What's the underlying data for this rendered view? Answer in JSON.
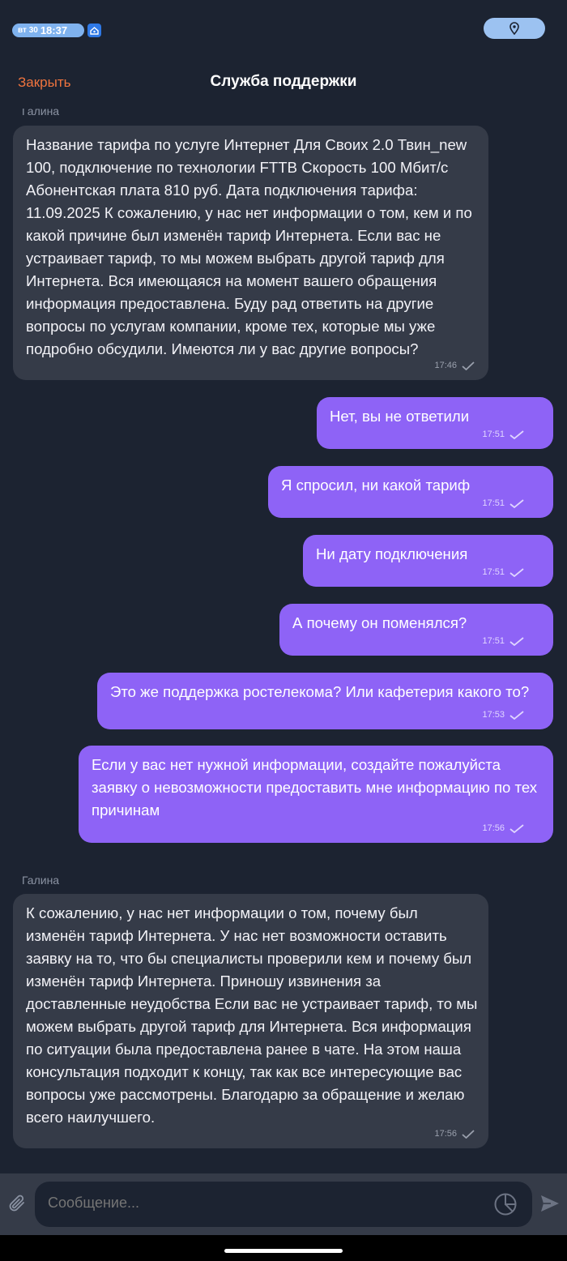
{
  "status": {
    "day": "вт 30",
    "time": "18:37"
  },
  "header": {
    "close_label": "Закрыть",
    "title": "Служба поддержки"
  },
  "messages": [
    {
      "type": "in",
      "sender": "Галина",
      "text": "Название тарифа по услуге Интернет Для Своих 2.0 Твин_new 100, подключение по технологии FTTB Скорость 100 Мбит/с Абонентская плата 810 руб. Дата подключения тарифа: 11.09.2025 К сожалению, у нас нет информации о том, кем и по какой причине был изменён тариф Интернета. Если вас не устраивает тариф, то мы можем выбрать другой тариф для Интернета. Вся имеющаяся на момент вашего обращения информация предоставлена. Буду рад ответить на другие вопросы по услугам компании, кроме тех, которые мы уже подробно обсудили. Имеются ли у вас другие вопросы?",
      "time": "17:46"
    },
    {
      "type": "out",
      "text": "Нет, вы не ответили",
      "time": "17:51"
    },
    {
      "type": "out",
      "text": "Я спросил, ни какой тариф",
      "time": "17:51"
    },
    {
      "type": "out",
      "text": "Ни дату подключения",
      "time": "17:51"
    },
    {
      "type": "out",
      "text": "А почему он поменялся?",
      "time": "17:51"
    },
    {
      "type": "out",
      "text": "Это же поддержка ростелекома? Или кафетерия какого то?",
      "time": "17:53"
    },
    {
      "type": "out",
      "text": "Если у вас нет нужной информации, создайте пожалуйста заявку о невозможности предоставить мне информацию по тех причинам",
      "time": "17:56"
    },
    {
      "type": "in",
      "sender": "Галина",
      "text": "К сожалению, у нас нет информации о том, почему был изменён тариф Интернета. У нас нет возможности оставить заявку на то, что бы специалисты проверили кем и почему был изменён тариф Интернета. Приношу извинения за доставленные неудобства Если вас не устраивает тариф, то мы можем выбрать другой тариф для Интернета. Вся информация по ситуации была предоставлена ранее в чате. На этом наша консультация подходит к концу, так как все интересующие вас вопросы уже рассмотрены. Благодарю за обращение и желаю всего наилучшего.",
      "time": "17:56"
    }
  ],
  "composer": {
    "placeholder": "Сообщение..."
  },
  "icons": {
    "alarm": "alarm-icon",
    "location": "location-pin-icon",
    "attach": "paperclip-icon",
    "sticker": "sticker-icon",
    "send": "send-icon",
    "check": "check-icon"
  },
  "colors": {
    "accent": "#f0743e",
    "outgoing_bubble": "#8e63f6",
    "incoming_bubble": "#353b48",
    "background": "#1c2331"
  }
}
